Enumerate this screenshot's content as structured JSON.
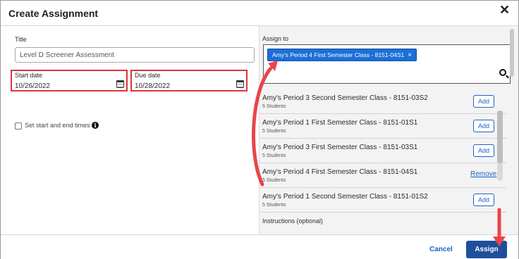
{
  "dialog": {
    "title": "Create Assignment",
    "close_glyph": "✕"
  },
  "form": {
    "title_label": "Title",
    "title_value": "Level D Screener Assessment",
    "start_label": "Start date",
    "start_value": "10/26/2022",
    "due_label": "Due date",
    "due_value": "10/28/2022",
    "times_label": "Set start and end times",
    "info_glyph": "i"
  },
  "assign": {
    "label": "Assign to",
    "selected_chip": "Amy's Period 4 First Semester Class - 8151-04S1",
    "chip_close": "×",
    "classes": [
      {
        "name": "Amy's Period 3 Second Semester Class - 8151-03S2",
        "students": "5 Students",
        "action": "Add"
      },
      {
        "name": "Amy's Period 1 First Semester Class - 8151-01S1",
        "students": "5 Students",
        "action": "Add"
      },
      {
        "name": "Amy's Period 3 First Semester Class - 8151-03S1",
        "students": "5 Students",
        "action": "Add"
      },
      {
        "name": "Amy's Period 4 First Semester Class - 8151-04S1",
        "students": "5 Students",
        "action": "Remove"
      },
      {
        "name": "Amy's Period 1 Second Semester Class - 8151-01S2",
        "students": "5 Students",
        "action": "Add"
      }
    ],
    "instructions_label": "Instructions (optional)"
  },
  "footer": {
    "cancel_label": "Cancel",
    "assign_label": "Assign"
  },
  "colors": {
    "accent": "#1b63c6",
    "highlight": "#e0323a",
    "primary_button": "#1f4f9c"
  }
}
